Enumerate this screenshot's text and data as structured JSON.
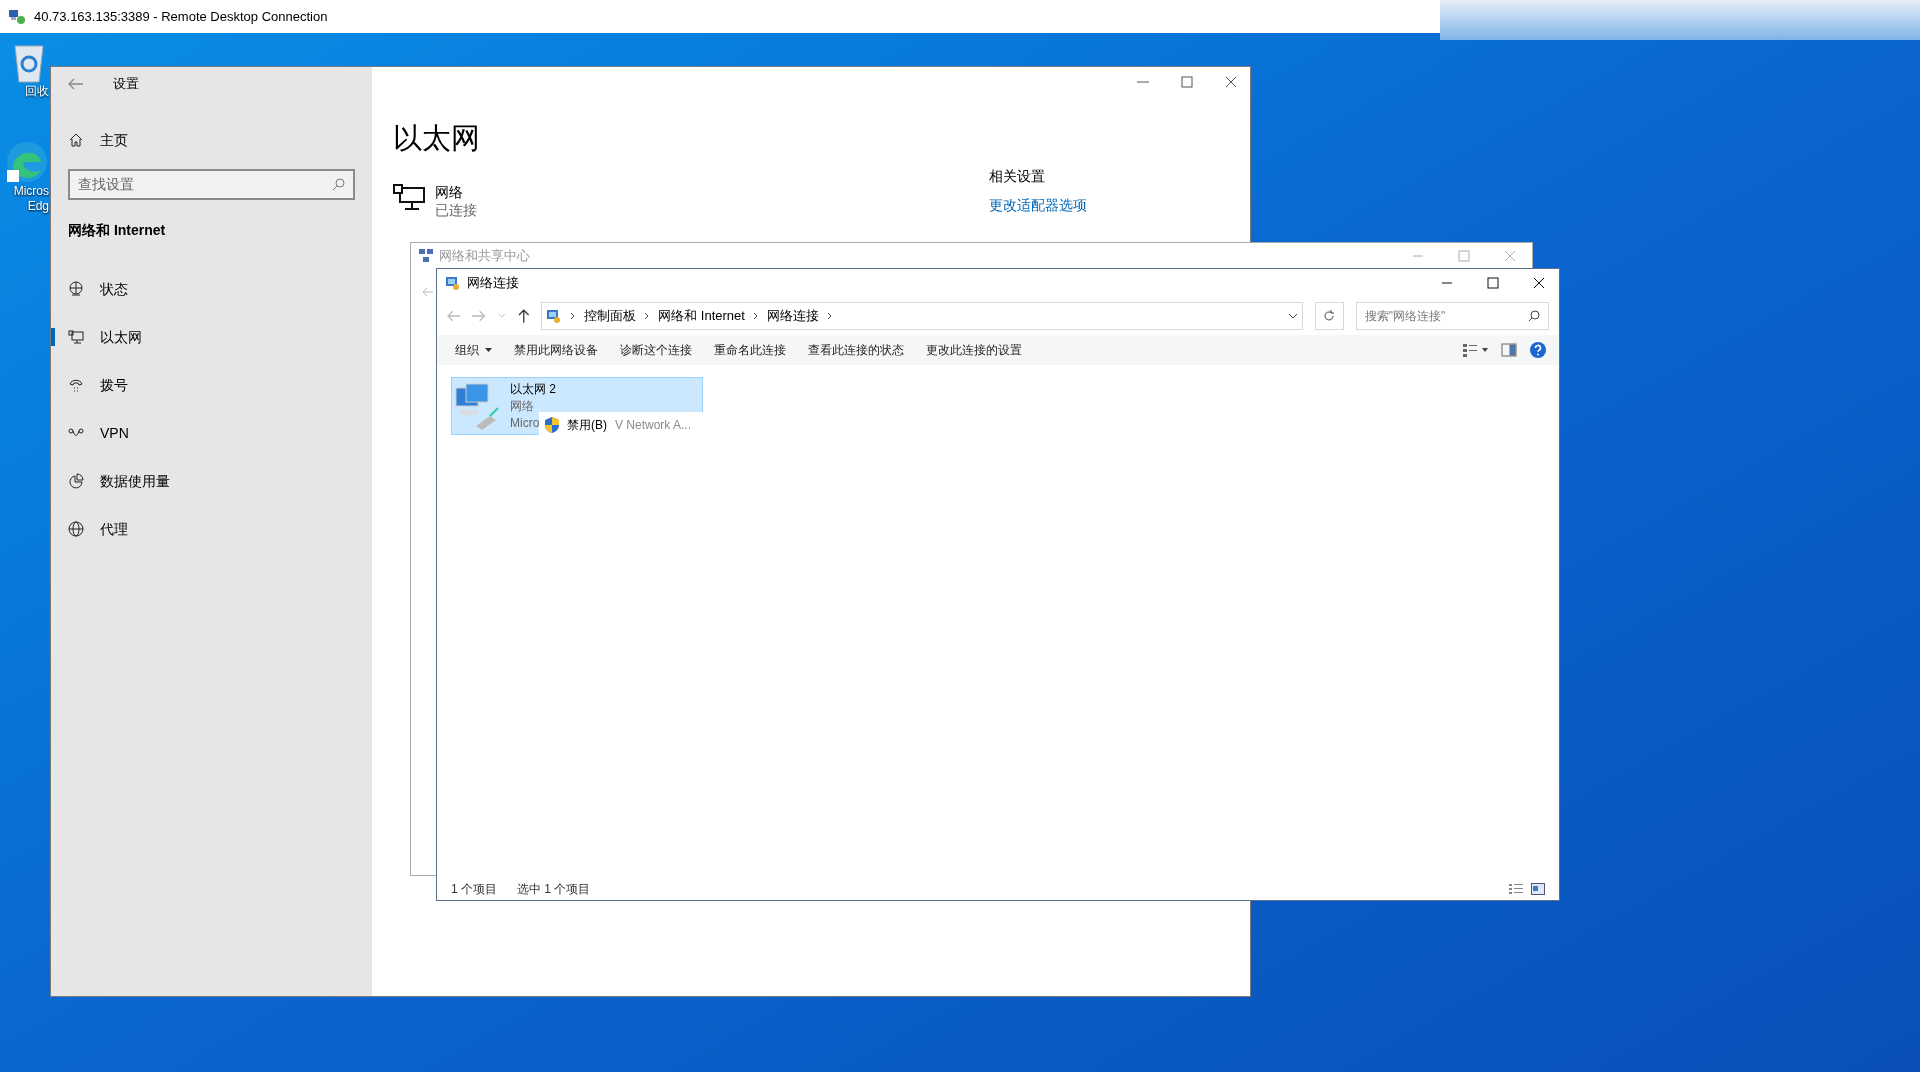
{
  "rdp_window": {
    "title": "40.73.163.135:3389 - Remote Desktop Connection"
  },
  "desktop_icons": [
    {
      "kind": "recycle-bin",
      "label": "回收"
    },
    {
      "kind": "browser",
      "label": "Micros Edg"
    }
  ],
  "settings": {
    "title": "设置",
    "home": "主页",
    "search": {
      "placeholder": "查找设置"
    },
    "section": "网络和 Internet",
    "nav": [
      {
        "kind": "status",
        "label": "状态",
        "selected": false
      },
      {
        "kind": "ethernet",
        "label": "以太网",
        "selected": true
      },
      {
        "kind": "dialup",
        "label": "拨号",
        "selected": false
      },
      {
        "kind": "vpn",
        "label": "VPN",
        "selected": false
      },
      {
        "kind": "data",
        "label": "数据使用量",
        "selected": false
      },
      {
        "kind": "proxy",
        "label": "代理",
        "selected": false
      }
    ],
    "page_title": "以太网",
    "network": {
      "name": "网络",
      "status": "已连接"
    },
    "related": {
      "heading": "相关设置",
      "links": [
        "更改适配器选项"
      ]
    }
  },
  "sharing_center": {
    "title": "网络和共享中心"
  },
  "connections": {
    "title": "网络连接",
    "breadcrumb": [
      "控制面板",
      "网络和 Internet",
      "网络连接"
    ],
    "search": {
      "placeholder": "搜索\"网络连接\""
    },
    "toolbar": [
      {
        "label": "组织",
        "kind": "menu"
      },
      {
        "label": "禁用此网络设备",
        "kind": "command"
      },
      {
        "label": "诊断这个连接",
        "kind": "command"
      },
      {
        "label": "重命名此连接",
        "kind": "command"
      },
      {
        "label": "查看此连接的状态",
        "kind": "command"
      },
      {
        "label": "更改此连接的设置",
        "kind": "command"
      }
    ],
    "items": [
      {
        "name": "以太网 2",
        "type": "网络",
        "device": "Micro",
        "selected": true
      }
    ],
    "context_menu": {
      "item": "禁用(B)",
      "behind": "V Network A..."
    },
    "status": [
      "1 个项目",
      "选中 1 个项目"
    ]
  }
}
